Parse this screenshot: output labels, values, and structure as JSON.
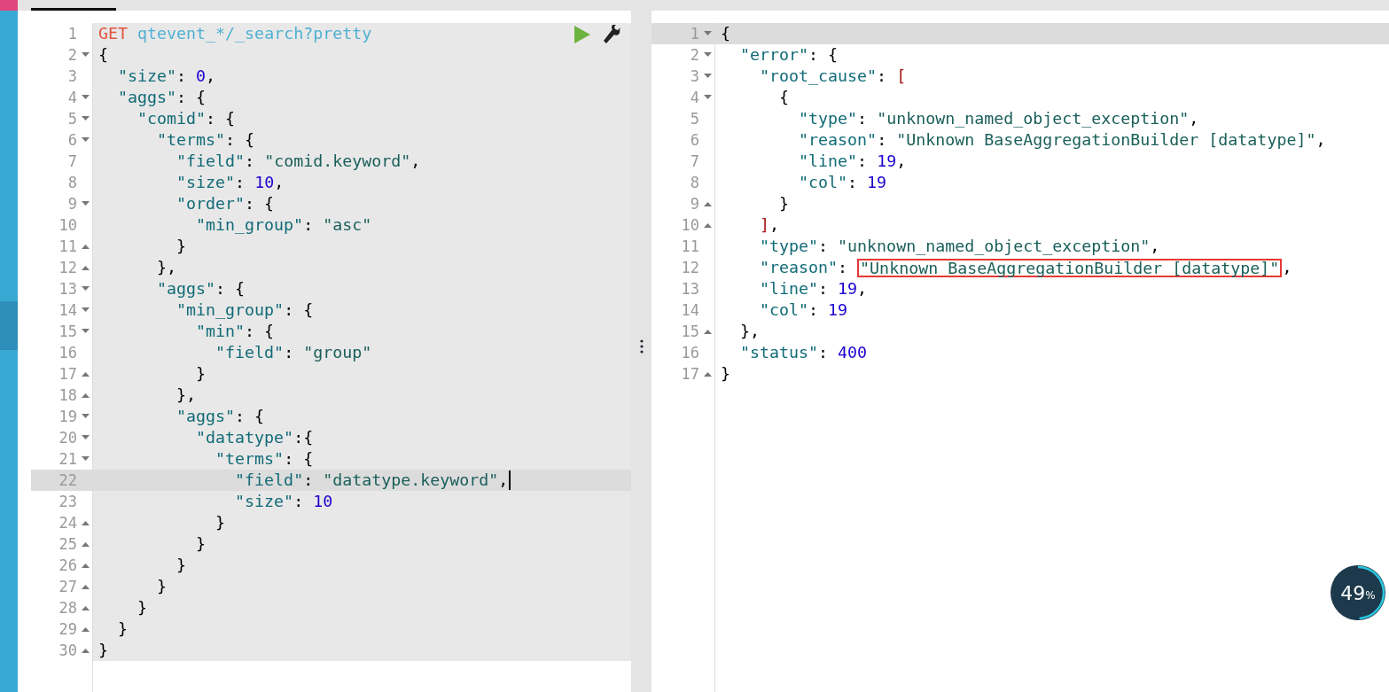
{
  "request_editor": {
    "lines": [
      {
        "n": "1",
        "fold_start": false,
        "fold_end": false,
        "active": false,
        "tokens": [
          {
            "kind": "method",
            "t": "GET"
          },
          {
            "kind": "url",
            "t": " qtevent_*/_search?pretty"
          }
        ]
      },
      {
        "n": "2",
        "fold_start": true,
        "fold_end": false,
        "active": false,
        "tokens": [
          {
            "kind": "punct",
            "t": "{"
          }
        ]
      },
      {
        "n": "3",
        "fold_start": false,
        "fold_end": false,
        "active": false,
        "tokens": [
          {
            "kind": "key",
            "t": "  \"size\""
          },
          {
            "kind": "punct",
            "t": ": "
          },
          {
            "kind": "number",
            "t": "0"
          },
          {
            "kind": "punct",
            "t": ","
          }
        ]
      },
      {
        "n": "4",
        "fold_start": true,
        "fold_end": false,
        "active": false,
        "tokens": [
          {
            "kind": "key",
            "t": "  \"aggs\""
          },
          {
            "kind": "punct",
            "t": ": {"
          }
        ]
      },
      {
        "n": "5",
        "fold_start": true,
        "fold_end": false,
        "active": false,
        "tokens": [
          {
            "kind": "key",
            "t": "    \"comid\""
          },
          {
            "kind": "punct",
            "t": ": {"
          }
        ]
      },
      {
        "n": "6",
        "fold_start": true,
        "fold_end": false,
        "active": false,
        "tokens": [
          {
            "kind": "key",
            "t": "      \"terms\""
          },
          {
            "kind": "punct",
            "t": ": {"
          }
        ]
      },
      {
        "n": "7",
        "fold_start": false,
        "fold_end": false,
        "active": false,
        "tokens": [
          {
            "kind": "key",
            "t": "        \"field\""
          },
          {
            "kind": "punct",
            "t": ": "
          },
          {
            "kind": "string",
            "t": "\"comid.keyword\""
          },
          {
            "kind": "punct",
            "t": ","
          }
        ]
      },
      {
        "n": "8",
        "fold_start": false,
        "fold_end": false,
        "active": false,
        "tokens": [
          {
            "kind": "key",
            "t": "        \"size\""
          },
          {
            "kind": "punct",
            "t": ": "
          },
          {
            "kind": "number",
            "t": "10"
          },
          {
            "kind": "punct",
            "t": ","
          }
        ]
      },
      {
        "n": "9",
        "fold_start": true,
        "fold_end": false,
        "active": false,
        "tokens": [
          {
            "kind": "key",
            "t": "        \"order\""
          },
          {
            "kind": "punct",
            "t": ": {"
          }
        ]
      },
      {
        "n": "10",
        "fold_start": false,
        "fold_end": false,
        "active": false,
        "tokens": [
          {
            "kind": "key",
            "t": "          \"min_group\""
          },
          {
            "kind": "punct",
            "t": ": "
          },
          {
            "kind": "string",
            "t": "\"asc\""
          }
        ]
      },
      {
        "n": "11",
        "fold_start": false,
        "fold_end": true,
        "active": false,
        "tokens": [
          {
            "kind": "punct",
            "t": "        }"
          }
        ]
      },
      {
        "n": "12",
        "fold_start": false,
        "fold_end": true,
        "active": false,
        "tokens": [
          {
            "kind": "punct",
            "t": "      },"
          }
        ]
      },
      {
        "n": "13",
        "fold_start": true,
        "fold_end": false,
        "active": false,
        "tokens": [
          {
            "kind": "key",
            "t": "      \"aggs\""
          },
          {
            "kind": "punct",
            "t": ": {"
          }
        ]
      },
      {
        "n": "14",
        "fold_start": true,
        "fold_end": false,
        "active": false,
        "tokens": [
          {
            "kind": "key",
            "t": "        \"min_group\""
          },
          {
            "kind": "punct",
            "t": ": {"
          }
        ]
      },
      {
        "n": "15",
        "fold_start": true,
        "fold_end": false,
        "active": false,
        "tokens": [
          {
            "kind": "key",
            "t": "          \"min\""
          },
          {
            "kind": "punct",
            "t": ": {"
          }
        ]
      },
      {
        "n": "16",
        "fold_start": false,
        "fold_end": false,
        "active": false,
        "tokens": [
          {
            "kind": "key",
            "t": "            \"field\""
          },
          {
            "kind": "punct",
            "t": ": "
          },
          {
            "kind": "string",
            "t": "\"group\""
          }
        ]
      },
      {
        "n": "17",
        "fold_start": false,
        "fold_end": true,
        "active": false,
        "tokens": [
          {
            "kind": "punct",
            "t": "          }"
          }
        ]
      },
      {
        "n": "18",
        "fold_start": false,
        "fold_end": true,
        "active": false,
        "tokens": [
          {
            "kind": "punct",
            "t": "        },"
          }
        ]
      },
      {
        "n": "19",
        "fold_start": true,
        "fold_end": false,
        "active": false,
        "tokens": [
          {
            "kind": "key",
            "t": "        \"aggs\""
          },
          {
            "kind": "punct",
            "t": ": {"
          }
        ]
      },
      {
        "n": "20",
        "fold_start": true,
        "fold_end": false,
        "active": false,
        "tokens": [
          {
            "kind": "key",
            "t": "          \"datatype\""
          },
          {
            "kind": "punct",
            "t": ":{"
          }
        ]
      },
      {
        "n": "21",
        "fold_start": true,
        "fold_end": false,
        "active": false,
        "tokens": [
          {
            "kind": "key",
            "t": "            \"terms\""
          },
          {
            "kind": "punct",
            "t": ": {"
          }
        ]
      },
      {
        "n": "22",
        "fold_start": false,
        "fold_end": false,
        "active": true,
        "tokens": [
          {
            "kind": "key",
            "t": "              \"field\""
          },
          {
            "kind": "punct",
            "t": ": "
          },
          {
            "kind": "string",
            "t": "\"datatype.keyword\""
          },
          {
            "kind": "punct",
            "t": ","
          }
        ]
      },
      {
        "n": "23",
        "fold_start": false,
        "fold_end": false,
        "active": false,
        "tokens": [
          {
            "kind": "key",
            "t": "              \"size\""
          },
          {
            "kind": "punct",
            "t": ": "
          },
          {
            "kind": "number",
            "t": "10"
          }
        ]
      },
      {
        "n": "24",
        "fold_start": false,
        "fold_end": true,
        "active": false,
        "tokens": [
          {
            "kind": "punct",
            "t": "            }"
          }
        ]
      },
      {
        "n": "25",
        "fold_start": false,
        "fold_end": true,
        "active": false,
        "tokens": [
          {
            "kind": "punct",
            "t": "          }"
          }
        ]
      },
      {
        "n": "26",
        "fold_start": false,
        "fold_end": true,
        "active": false,
        "tokens": [
          {
            "kind": "punct",
            "t": "        }"
          }
        ]
      },
      {
        "n": "27",
        "fold_start": false,
        "fold_end": true,
        "active": false,
        "tokens": [
          {
            "kind": "punct",
            "t": "      }"
          }
        ]
      },
      {
        "n": "28",
        "fold_start": false,
        "fold_end": true,
        "active": false,
        "tokens": [
          {
            "kind": "punct",
            "t": "    }"
          }
        ]
      },
      {
        "n": "29",
        "fold_start": false,
        "fold_end": true,
        "active": false,
        "tokens": [
          {
            "kind": "punct",
            "t": "  }"
          }
        ]
      },
      {
        "n": "30",
        "fold_start": false,
        "fold_end": true,
        "active": false,
        "tokens": [
          {
            "kind": "punct",
            "t": "}"
          }
        ]
      }
    ]
  },
  "response_viewer": {
    "lines": [
      {
        "n": "1",
        "fold_start": true,
        "fold_end": false,
        "active": true,
        "tokens": [
          {
            "kind": "punct",
            "t": "{"
          }
        ]
      },
      {
        "n": "2",
        "fold_start": true,
        "fold_end": false,
        "active": false,
        "tokens": [
          {
            "kind": "key",
            "t": "  \"error\""
          },
          {
            "kind": "punct",
            "t": ": {"
          }
        ]
      },
      {
        "n": "3",
        "fold_start": true,
        "fold_end": false,
        "active": false,
        "tokens": [
          {
            "kind": "key",
            "t": "    \"root_cause\""
          },
          {
            "kind": "punct",
            "t": ": "
          },
          {
            "kind": "bracket",
            "t": "["
          }
        ]
      },
      {
        "n": "4",
        "fold_start": true,
        "fold_end": false,
        "active": false,
        "tokens": [
          {
            "kind": "punct",
            "t": "      {"
          }
        ]
      },
      {
        "n": "5",
        "fold_start": false,
        "fold_end": false,
        "active": false,
        "tokens": [
          {
            "kind": "key",
            "t": "        \"type\""
          },
          {
            "kind": "punct",
            "t": ": "
          },
          {
            "kind": "string",
            "t": "\"unknown_named_object_exception\""
          },
          {
            "kind": "punct",
            "t": ","
          }
        ]
      },
      {
        "n": "6",
        "fold_start": false,
        "fold_end": false,
        "active": false,
        "tokens": [
          {
            "kind": "key",
            "t": "        \"reason\""
          },
          {
            "kind": "punct",
            "t": ": "
          },
          {
            "kind": "string",
            "t": "\"Unknown BaseAggregationBuilder [datatype]\""
          },
          {
            "kind": "punct",
            "t": ","
          }
        ]
      },
      {
        "n": "7",
        "fold_start": false,
        "fold_end": false,
        "active": false,
        "tokens": [
          {
            "kind": "key",
            "t": "        \"line\""
          },
          {
            "kind": "punct",
            "t": ": "
          },
          {
            "kind": "number",
            "t": "19"
          },
          {
            "kind": "punct",
            "t": ","
          }
        ]
      },
      {
        "n": "8",
        "fold_start": false,
        "fold_end": false,
        "active": false,
        "tokens": [
          {
            "kind": "key",
            "t": "        \"col\""
          },
          {
            "kind": "punct",
            "t": ": "
          },
          {
            "kind": "number",
            "t": "19"
          }
        ]
      },
      {
        "n": "9",
        "fold_start": false,
        "fold_end": true,
        "active": false,
        "tokens": [
          {
            "kind": "punct",
            "t": "      }"
          }
        ]
      },
      {
        "n": "10",
        "fold_start": false,
        "fold_end": true,
        "active": false,
        "tokens": [
          {
            "kind": "bracket",
            "t": "    ]"
          },
          {
            "kind": "punct",
            "t": ","
          }
        ]
      },
      {
        "n": "11",
        "fold_start": false,
        "fold_end": false,
        "active": false,
        "tokens": [
          {
            "kind": "key",
            "t": "    \"type\""
          },
          {
            "kind": "punct",
            "t": ": "
          },
          {
            "kind": "string",
            "t": "\"unknown_named_object_exception\""
          },
          {
            "kind": "punct",
            "t": ","
          }
        ]
      },
      {
        "n": "12",
        "fold_start": false,
        "fold_end": false,
        "active": false,
        "tokens": [
          {
            "kind": "key",
            "t": "    \"reason\""
          },
          {
            "kind": "punct",
            "t": ": "
          },
          {
            "kind": "string",
            "t": "\"Unknown BaseAggregationBuilder [datatype]\"",
            "boxed": true
          },
          {
            "kind": "punct",
            "t": ","
          }
        ]
      },
      {
        "n": "13",
        "fold_start": false,
        "fold_end": false,
        "active": false,
        "tokens": [
          {
            "kind": "key",
            "t": "    \"line\""
          },
          {
            "kind": "punct",
            "t": ": "
          },
          {
            "kind": "number",
            "t": "19"
          },
          {
            "kind": "punct",
            "t": ","
          }
        ]
      },
      {
        "n": "14",
        "fold_start": false,
        "fold_end": false,
        "active": false,
        "tokens": [
          {
            "kind": "key",
            "t": "    \"col\""
          },
          {
            "kind": "punct",
            "t": ": "
          },
          {
            "kind": "number",
            "t": "19"
          }
        ]
      },
      {
        "n": "15",
        "fold_start": false,
        "fold_end": true,
        "active": false,
        "tokens": [
          {
            "kind": "punct",
            "t": "  },"
          }
        ]
      },
      {
        "n": "16",
        "fold_start": false,
        "fold_end": false,
        "active": false,
        "tokens": [
          {
            "kind": "key",
            "t": "  \"status\""
          },
          {
            "kind": "punct",
            "t": ": "
          },
          {
            "kind": "number",
            "t": "400"
          }
        ]
      },
      {
        "n": "17",
        "fold_start": false,
        "fold_end": true,
        "active": false,
        "tokens": [
          {
            "kind": "punct",
            "t": "}"
          }
        ]
      }
    ]
  },
  "progress_badge": {
    "value": "49",
    "unit": "%",
    "level": 0.49
  }
}
